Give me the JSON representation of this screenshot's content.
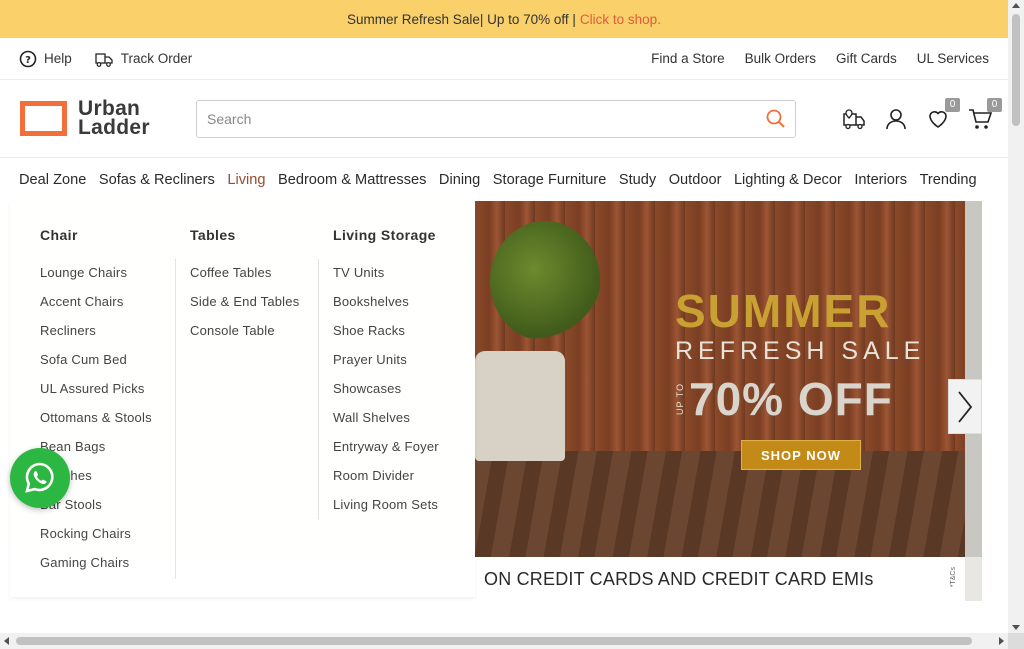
{
  "promo": {
    "text": "Summer Refresh Sale| Up to 70% off | ",
    "cta": "Click to shop."
  },
  "utility": {
    "help": "Help",
    "track_order": "Track Order",
    "right_links": [
      "Find a Store",
      "Bulk Orders",
      "Gift Cards",
      "UL Services"
    ]
  },
  "header": {
    "logo_line1": "Urban",
    "logo_line2": "Ladder",
    "search_placeholder": "Search",
    "wishlist_count": "0",
    "cart_count": "0",
    "accent_color": "#f26f3b"
  },
  "nav": {
    "items": [
      "Deal Zone",
      "Sofas & Recliners",
      "Living",
      "Bedroom & Mattresses",
      "Dining",
      "Storage Furniture",
      "Study",
      "Outdoor",
      "Lighting & Decor",
      "Interiors",
      "Trending"
    ],
    "active": "Living"
  },
  "mega_menu": {
    "columns": [
      {
        "heading": "Chair",
        "links": [
          "Lounge Chairs",
          "Accent Chairs",
          "Recliners",
          "Sofa Cum Bed",
          "UL Assured Picks",
          "Ottomans & Stools",
          "Bean Bags",
          "Benches",
          "Bar Stools",
          "Rocking Chairs",
          "Gaming Chairs"
        ]
      },
      {
        "heading": "Tables",
        "links": [
          "Coffee Tables",
          "Side & End Tables",
          "Console Table"
        ]
      },
      {
        "heading": "Living Storage",
        "links": [
          "TV Units",
          "Bookshelves",
          "Shoe Racks",
          "Prayer Units",
          "Showcases",
          "Wall Shelves",
          "Entryway & Foyer",
          "Room Divider",
          "Living Room Sets"
        ]
      }
    ]
  },
  "hero": {
    "title": "SUMMER",
    "subtitle": "REFRESH SALE",
    "upto": "UP TO",
    "discount": "70% OFF",
    "button": "SHOP NOW",
    "offer_text": "ON CREDIT CARDS AND CREDIT CARD EMIs",
    "tc": "*T&Cs"
  }
}
